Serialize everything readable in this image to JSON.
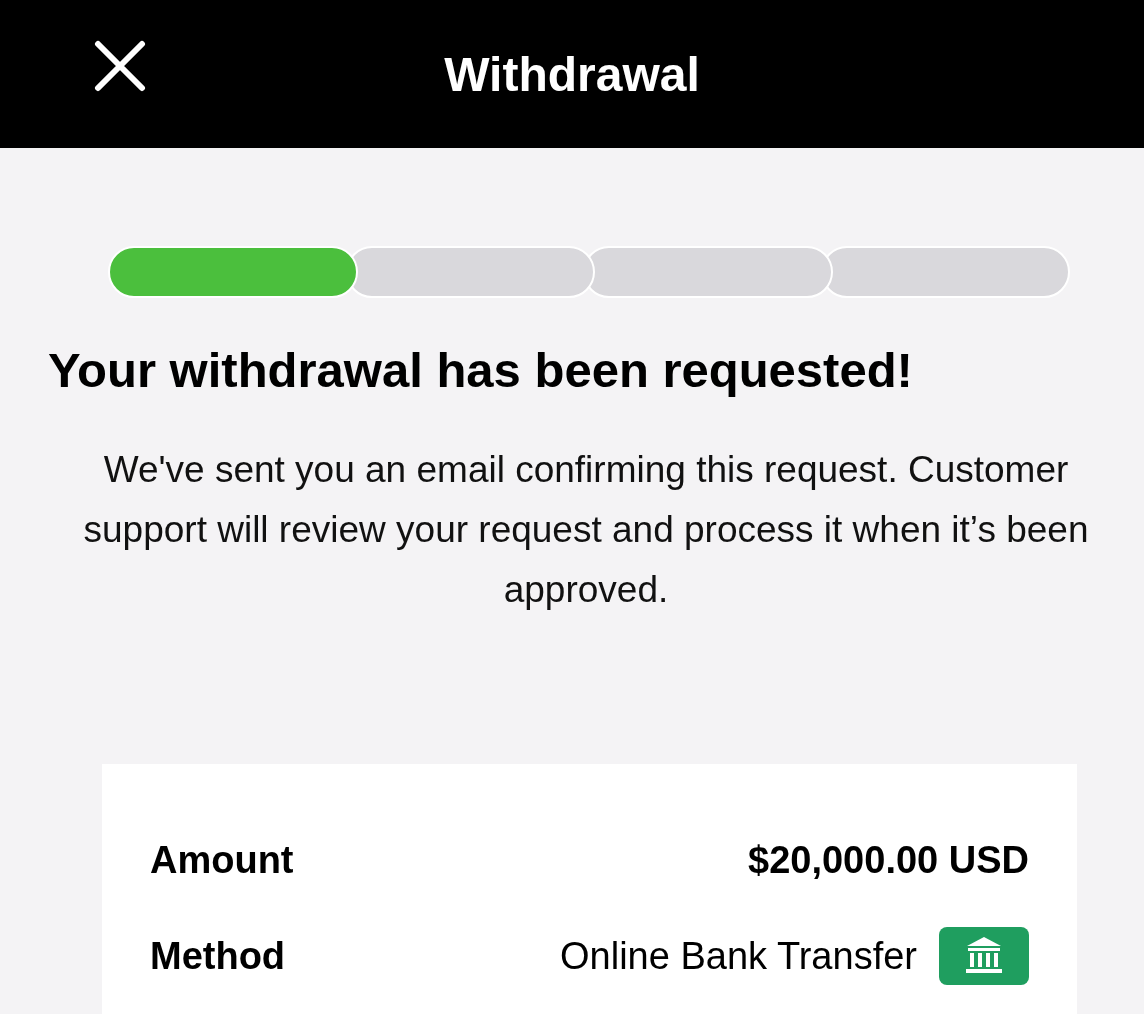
{
  "header": {
    "title": "Withdrawal"
  },
  "progress": {
    "steps": [
      {
        "done": true
      },
      {
        "done": false
      },
      {
        "done": false
      },
      {
        "done": false
      }
    ]
  },
  "heading": "Your withdrawal has been requested!",
  "message": "We've sent you an email confirming this request. Customer support will review your request and process it when it’s been approved.",
  "details": [
    {
      "label": "Amount",
      "value": "$20,000.00 USD",
      "kind": "bold"
    },
    {
      "label": "Method",
      "value": "Online Bank Transfer",
      "kind": "bank"
    }
  ]
}
